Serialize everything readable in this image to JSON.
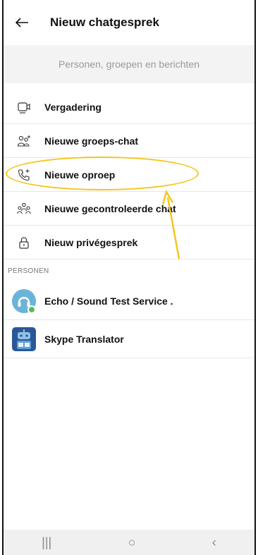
{
  "header": {
    "title": "Nieuw chatgesprek",
    "back_icon": "arrow-left-icon"
  },
  "search": {
    "placeholder": "Personen, groepen en berichten"
  },
  "menu": {
    "items": [
      {
        "label": "Vergadering",
        "icon": "video-camera-icon"
      },
      {
        "label": "Nieuwe groeps-chat",
        "icon": "add-group-icon"
      },
      {
        "label": "Nieuwe oproep",
        "icon": "phone-plus-icon"
      },
      {
        "label": "Nieuwe gecontroleerde chat",
        "icon": "group-icon"
      },
      {
        "label": "Nieuw privégesprek",
        "icon": "lock-icon"
      }
    ]
  },
  "section": {
    "title": "PERSONEN"
  },
  "contacts": [
    {
      "name": "Echo / Sound Test Service .",
      "status": "online",
      "avatar_color": "#6bb3d8"
    },
    {
      "name": "Skype Translator",
      "avatar_color": "#2b5797"
    }
  ],
  "annotation": {
    "color": "#f5c518"
  },
  "navbar": {
    "recent": "|||",
    "home": "○",
    "back": "‹"
  }
}
